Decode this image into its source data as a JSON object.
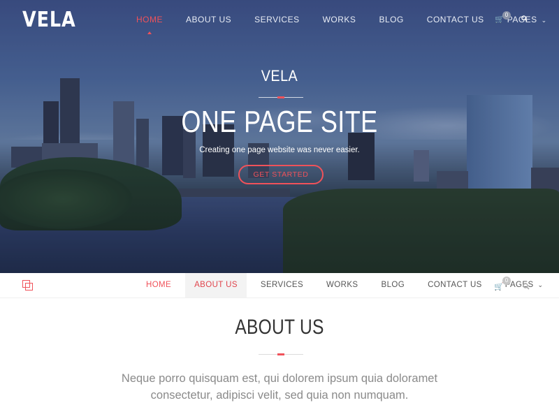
{
  "brand": {
    "logo": "VELA"
  },
  "top_nav": {
    "items": [
      "HOME",
      "ABOUT US",
      "SERVICES",
      "WORKS",
      "BLOG",
      "CONTACT US",
      "PAGES"
    ],
    "cart_count": "0",
    "cart_icon": "cart-icon",
    "search_icon": "search-icon"
  },
  "hero": {
    "subtitle": "VELA",
    "title": "ONE PAGE SITE",
    "tagline": "Creating one page website was never easier.",
    "cta": "GET STARTED"
  },
  "sticky_nav": {
    "logo_icon": "overlapping-squares-icon",
    "items": [
      "HOME",
      "ABOUT US",
      "SERVICES",
      "WORKS",
      "BLOG",
      "CONTACT US",
      "PAGES"
    ],
    "cart_count": "0"
  },
  "about": {
    "title": "ABOUT US",
    "text": "Neque porro quisquam est, qui dolorem ipsum quia doloramet consectetur, adipisci velit, sed quia non numquam."
  },
  "colors": {
    "accent": "#f0525a",
    "hero_overlay": "#2b3a6e",
    "text_muted": "#8a8a8a"
  }
}
